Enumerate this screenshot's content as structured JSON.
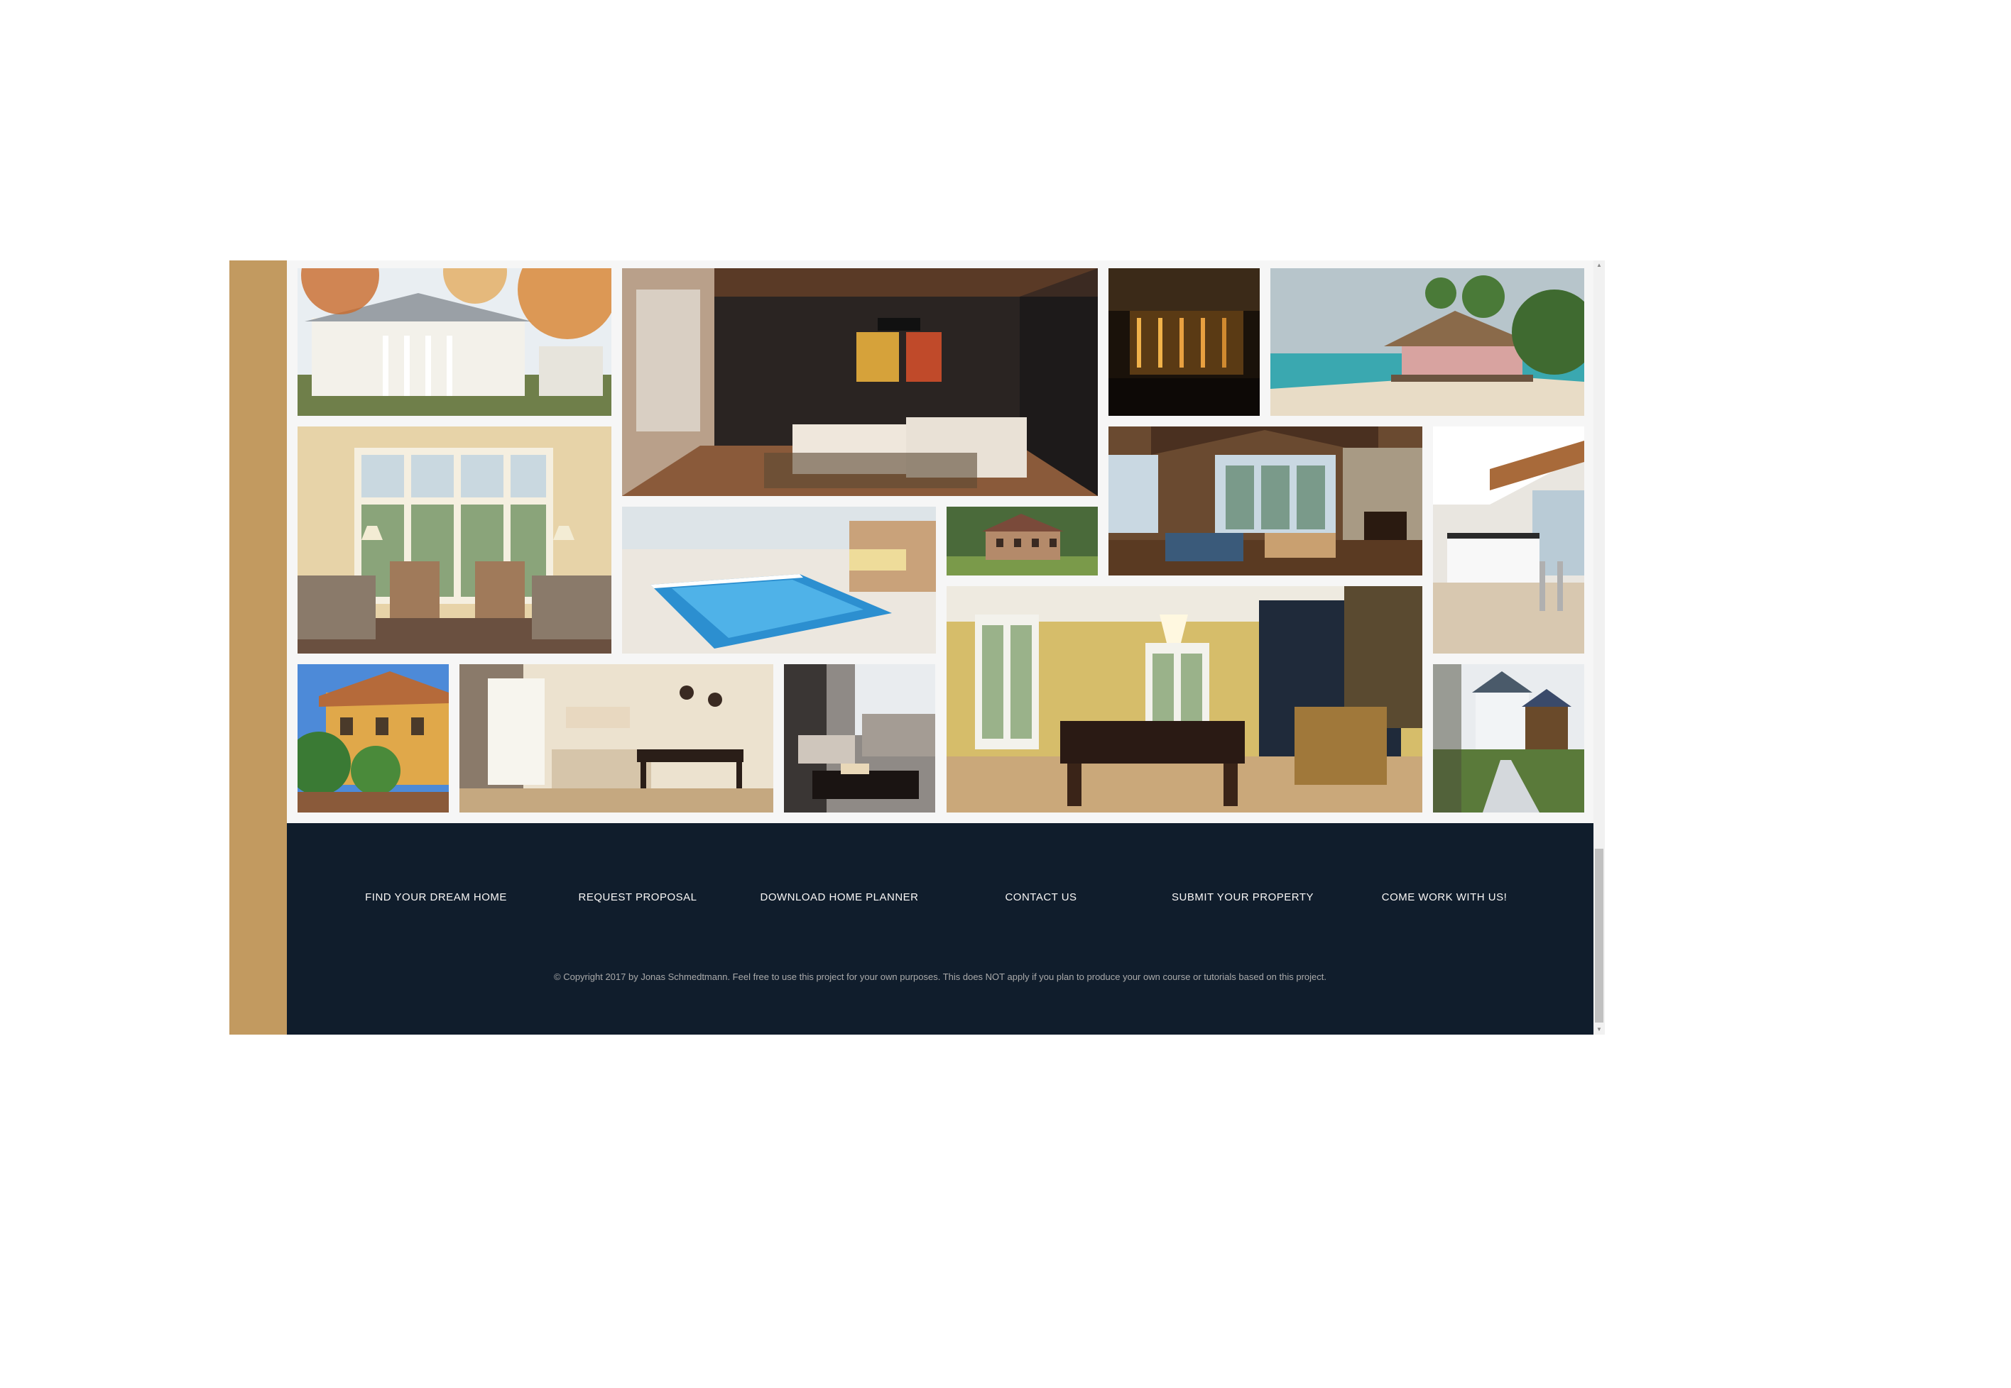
{
  "colors": {
    "sidebar": "#c29a60",
    "footer": "#101d2c",
    "gallery_bg": "#f6f6f6",
    "footer_text": "#f9f7f6",
    "copyright_text": "#aaaaaa"
  },
  "gallery": {
    "images": [
      "colonial-house-autumn",
      "modern-living-room",
      "bar-lounge",
      "beach-hut-resort",
      "sunroom-armchairs",
      "indoor-pool",
      "brick-mansion-lawn",
      "stone-fireplace-great-room",
      "white-kitchen",
      "mediterranean-villa",
      "dining-living-room",
      "grey-sofa-lounge",
      "billiard-room",
      "white-house-driveway"
    ]
  },
  "footer": {
    "nav": [
      "FIND YOUR DREAM HOME",
      "REQUEST PROPOSAL",
      "DOWNLOAD HOME PLANNER",
      "CONTACT US",
      "SUBMIT YOUR PROPERTY",
      "COME WORK WITH US!"
    ],
    "copyright": "© Copyright 2017 by Jonas Schmedtmann. Feel free to use this project for your own purposes. This does NOT apply if you plan to produce your own course or tutorials based on this project."
  },
  "scrollbar": {
    "up_icon": "triangle-up",
    "down_icon": "triangle-down"
  }
}
